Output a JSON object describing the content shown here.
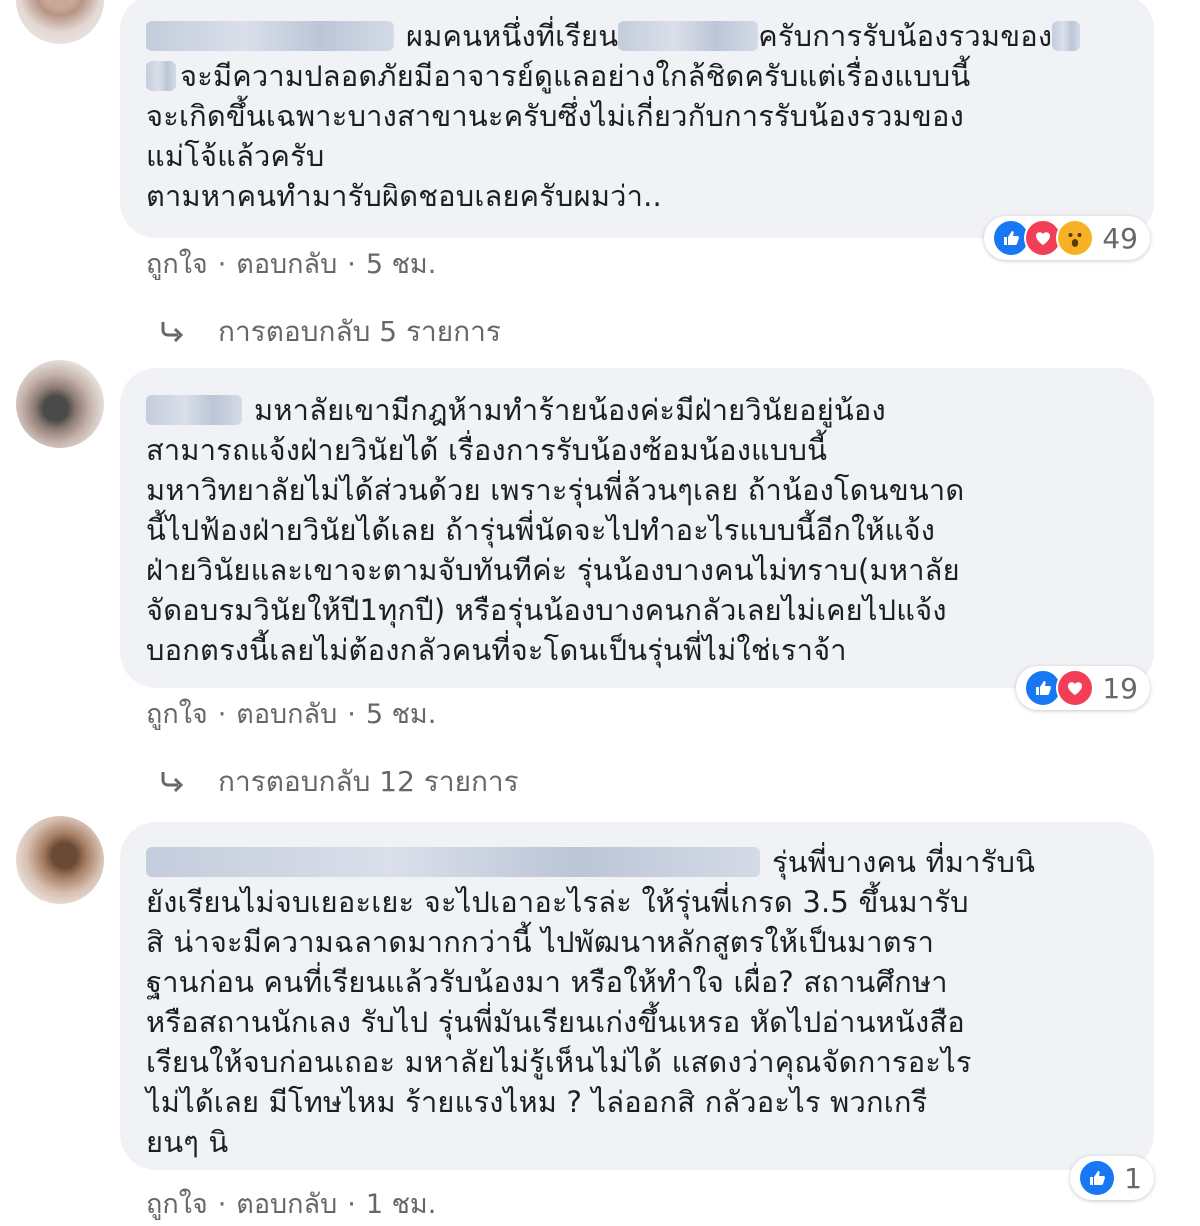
{
  "comments": [
    {
      "lines": [
        "ผมคนหนึ่งที่เรียน",
        "จะมีความปลอดภัยมีอาจารย์ดูแลอย่างใกล้ชิดครับแต่เรื่องแบบนี้",
        "จะเกิดขึ้นเฉพาะบางสาขานะครับซึ่งไม่เกี่ยวกับการรับน้องรวมของ",
        "แม่โจ้แล้วครับ",
        "ตามหาคนทำมารับผิดชอบเลยครับผมว่า.."
      ],
      "line1_tail": "ครับการรับน้องรวมของ",
      "reaction_count": "49",
      "like_label": "ถูกใจ",
      "reply_label": "ตอบกลับ",
      "time": "5 ชม.",
      "replies_label": "การตอบกลับ 5 รายการ"
    },
    {
      "lines": [
        "มหาลัยเขามีกฎห้ามทำร้ายน้องค่ะมีฝ่ายวินัยอยู่น้อง",
        "สามารถแจ้งฝ่ายวินัยได้ เรื่องการรับน้องซ้อมน้องแบบนี้",
        "มหาวิทยาลัยไม่ได้ส่วนด้วย เพราะรุ่นพี่ล้วนๆเลย ถ้าน้องโดนขนาด",
        "นี้ไปฟ้องฝ่ายวินัยได้เลย ถ้ารุ่นพี่นัดจะไปทำอะไรแบบนี้อีกให้แจ้ง",
        "ฝ่ายวินัยและเขาจะตามจับทันทีค่ะ รุ่นน้องบางคนไม่ทราบ(มหาลัย",
        "จัดอบรมวินัยให้ปี1ทุกปี) หรือรุ่นน้องบางคนกลัวเลยไม่เคยไปแจ้ง",
        "บอกตรงนี้เลยไม่ต้องกลัวคนที่จะโดนเป็นรุ่นพี่ไม่ใช่เราจ้า"
      ],
      "reaction_count": "19",
      "like_label": "ถูกใจ",
      "reply_label": "ตอบกลับ",
      "time": "5 ชม.",
      "replies_label": "การตอบกลับ 12 รายการ"
    },
    {
      "lines": [
        "รุ่นพี่บางคน ที่มารับนิ",
        "ยังเรียนไม่จบเยอะเยะ จะไปเอาอะไรล่ะ ให้รุ่นพี่เกรด 3.5 ขึ้นมารับ",
        "สิ น่าจะมีความฉลาดมากกว่านี้ ไปพัฒนาหลักสูตรให้เป็นมาตรา",
        "ฐานก่อน คนที่เรียนแล้วรับน้องมา หรือให้ทำใจ เผื่อ? สถานศึกษา",
        "หรือสถานนักเลง รับไป รุ่นพี่มันเรียนเก่งขึ้นเหรอ หัดไปอ่านหนังสือ",
        "เรียนให้จบก่อนเถอะ มหาลัยไม่รู้เห็นไม่ได้ แสดงว่าคุณจัดการอะไร",
        "ไม่ได้เลย มีโทษไหม ร้ายแรงไหม ? ไล่ออกสิ กลัวอะไร พวกเกรี",
        "ยนๆ นิ"
      ],
      "reaction_count": "1",
      "like_label": "ถูกใจ",
      "reply_label": "ตอบกลับ",
      "time": "1 ชม."
    }
  ],
  "colors": {
    "bubble": "#f0f2f5",
    "meta_text": "#65676b",
    "like": "#1877f2",
    "love": "#f33e58",
    "wow": "#f7b125"
  },
  "icons": [
    "like-icon",
    "love-icon",
    "wow-icon",
    "reply-arrow-icon"
  ]
}
